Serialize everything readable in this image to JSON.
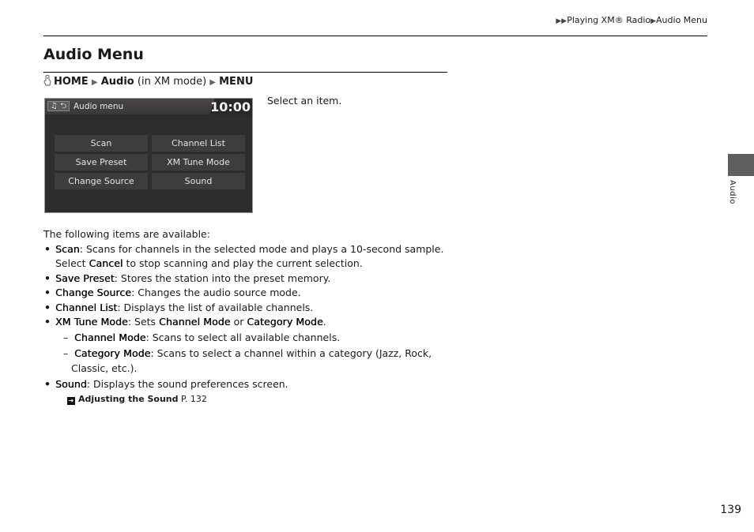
{
  "header": {
    "breadcrumb": [
      "Playing XM® Radio",
      "Audio Menu"
    ]
  },
  "page_title": "Audio Menu",
  "nav_path": {
    "icon": "finger-press-icon",
    "home": "HOME",
    "audio": "Audio",
    "audio_note": "(in XM mode)",
    "menu": "MENU"
  },
  "screen": {
    "title": "Audio menu",
    "clock": "10:00",
    "icons": "♫ ⮌",
    "buttons": [
      "Scan",
      "Channel List",
      "Save Preset",
      "XM Tune Mode",
      "Change Source",
      "Sound"
    ]
  },
  "select_hint": "Select an item.",
  "body": {
    "intro": "The following items are available:",
    "items": [
      {
        "term": "Scan",
        "text": ": Scans for channels in the selected mode and plays a 10-second sample.",
        "line2_pre": "Select ",
        "line2_term": "Cancel",
        "line2_post": " to stop scanning and play the current selection."
      },
      {
        "term": "Save Preset",
        "text": ": Stores the station into the preset memory."
      },
      {
        "term": "Change Source",
        "text": ": Changes the audio source mode."
      },
      {
        "term": "Channel List",
        "text": ": Displays the list of available channels."
      },
      {
        "term": "XM Tune Mode",
        "text": ": Sets ",
        "term2": "Channel Mode",
        "mid": " or ",
        "term3": "Category Mode",
        "end": ".",
        "sub": [
          {
            "term": "Channel Mode",
            "text": ": Scans to select all available channels."
          },
          {
            "term": "Category Mode",
            "text": ": Scans to select a channel within a category (Jazz, Rock,",
            "wrap": "Classic, etc.)."
          }
        ]
      },
      {
        "term": "Sound",
        "text": ": Displays the sound preferences screen."
      }
    ],
    "xref": {
      "label": "Adjusting the Sound",
      "page": "P. 132"
    }
  },
  "side_tab": {
    "label": "Audio"
  },
  "page_number": "139"
}
